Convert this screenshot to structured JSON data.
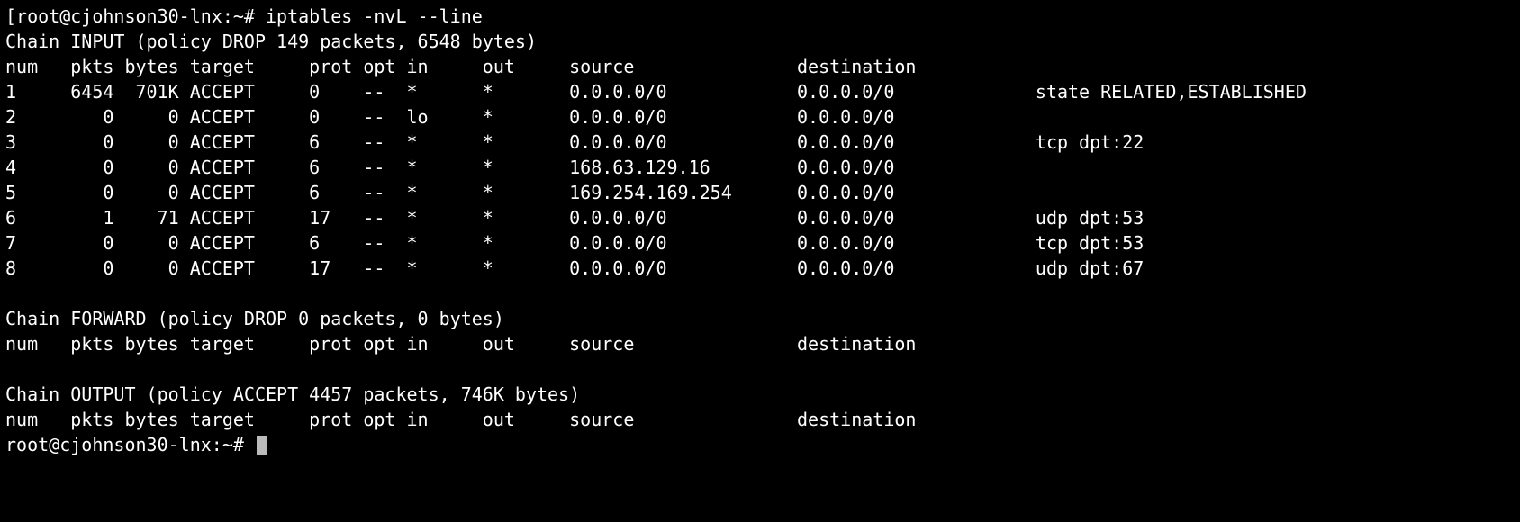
{
  "prompt1": "[root@cjohnson30-lnx:~# ",
  "command": "iptables -nvL --line",
  "input_chain_header": "Chain INPUT (policy DROP 149 packets, 6548 bytes)",
  "col_header": {
    "num": "num",
    "pkts": "pkts",
    "bytes": "bytes",
    "target": "target",
    "prot": "prot",
    "opt": "opt",
    "in": "in",
    "out": "out",
    "source": "source",
    "destination": "destination"
  },
  "input_rules": [
    {
      "num": "1",
      "pkts": "6454",
      "bytes": "701K",
      "target": "ACCEPT",
      "prot": "0",
      "opt": "--",
      "in": "*",
      "out": "*",
      "source": "0.0.0.0/0",
      "dest": "0.0.0.0/0",
      "extra": "state RELATED,ESTABLISHED"
    },
    {
      "num": "2",
      "pkts": "0",
      "bytes": "0",
      "target": "ACCEPT",
      "prot": "0",
      "opt": "--",
      "in": "lo",
      "out": "*",
      "source": "0.0.0.0/0",
      "dest": "0.0.0.0/0",
      "extra": ""
    },
    {
      "num": "3",
      "pkts": "0",
      "bytes": "0",
      "target": "ACCEPT",
      "prot": "6",
      "opt": "--",
      "in": "*",
      "out": "*",
      "source": "0.0.0.0/0",
      "dest": "0.0.0.0/0",
      "extra": "tcp dpt:22"
    },
    {
      "num": "4",
      "pkts": "0",
      "bytes": "0",
      "target": "ACCEPT",
      "prot": "6",
      "opt": "--",
      "in": "*",
      "out": "*",
      "source": "168.63.129.16",
      "dest": "0.0.0.0/0",
      "extra": ""
    },
    {
      "num": "5",
      "pkts": "0",
      "bytes": "0",
      "target": "ACCEPT",
      "prot": "6",
      "opt": "--",
      "in": "*",
      "out": "*",
      "source": "169.254.169.254",
      "dest": "0.0.0.0/0",
      "extra": ""
    },
    {
      "num": "6",
      "pkts": "1",
      "bytes": "71",
      "target": "ACCEPT",
      "prot": "17",
      "opt": "--",
      "in": "*",
      "out": "*",
      "source": "0.0.0.0/0",
      "dest": "0.0.0.0/0",
      "extra": "udp dpt:53"
    },
    {
      "num": "7",
      "pkts": "0",
      "bytes": "0",
      "target": "ACCEPT",
      "prot": "6",
      "opt": "--",
      "in": "*",
      "out": "*",
      "source": "0.0.0.0/0",
      "dest": "0.0.0.0/0",
      "extra": "tcp dpt:53"
    },
    {
      "num": "8",
      "pkts": "0",
      "bytes": "0",
      "target": "ACCEPT",
      "prot": "17",
      "opt": "--",
      "in": "*",
      "out": "*",
      "source": "0.0.0.0/0",
      "dest": "0.0.0.0/0",
      "extra": "udp dpt:67"
    }
  ],
  "forward_chain_header": "Chain FORWARD (policy DROP 0 packets, 0 bytes)",
  "output_chain_header": "Chain OUTPUT (policy ACCEPT 4457 packets, 746K bytes)",
  "prompt2": "root@cjohnson30-lnx:~# "
}
